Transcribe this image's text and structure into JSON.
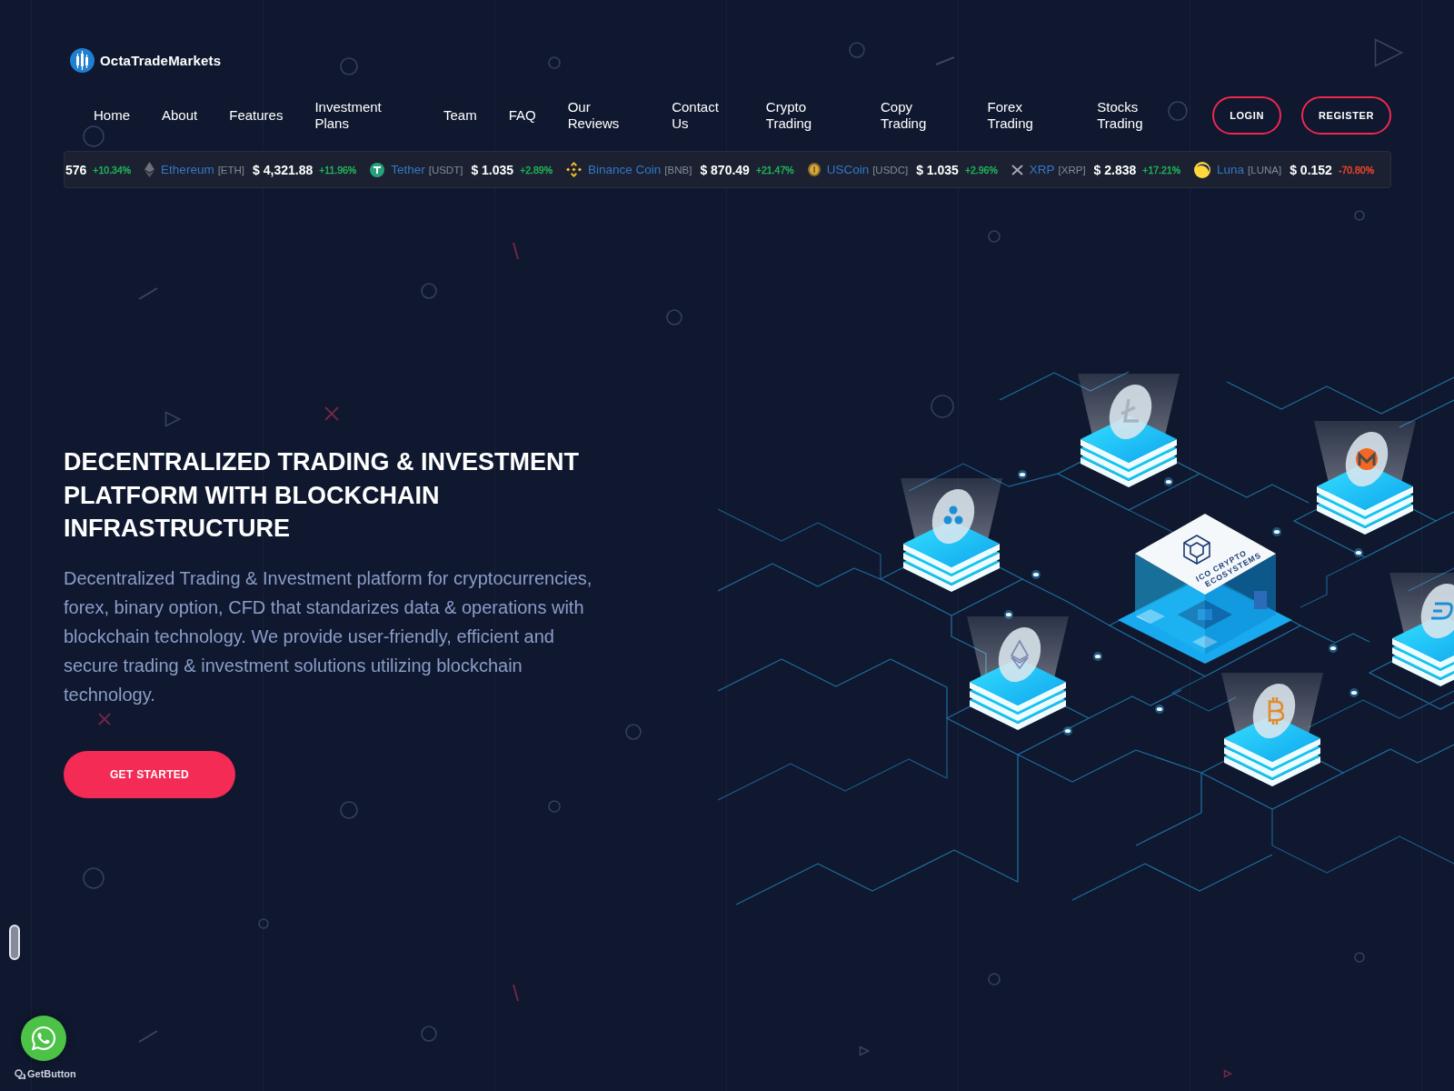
{
  "logo": {
    "name": "OctaTradeMarkets"
  },
  "nav": {
    "items": [
      "Home",
      "About",
      "Features",
      "Investment Plans",
      "Team",
      "FAQ",
      "Our Reviews",
      "Contact Us",
      "Crypto Trading",
      "Copy Trading",
      "Forex Trading",
      "Stocks Trading"
    ]
  },
  "auth_buttons": [
    "LOGIN",
    "REGISTER"
  ],
  "ticker": {
    "items": [
      {
        "price": "576",
        "change": "+10.34%",
        "color": "#21b35b"
      },
      {
        "name": "Ethereum",
        "symbol": "[ETH]",
        "price": "$ 4,321.88",
        "change": "+11.96%",
        "color": "#21b35b"
      },
      {
        "name": "Tether",
        "symbol": "[USDT]",
        "price": "$ 1.035",
        "change": "+2.89%",
        "color": "#21b35b"
      },
      {
        "name": "Binance Coin",
        "symbol": "[BNB]",
        "price": "$ 870.49",
        "change": "+21.47%",
        "color": "#21b35b"
      },
      {
        "name": "USCoin",
        "symbol": "[USDC]",
        "price": "$ 1.035",
        "change": "+2.96%",
        "color": "#21b35b"
      },
      {
        "name": "XRP",
        "symbol": "[XRP]",
        "price": "$ 2.838",
        "change": "+17.21%",
        "color": "#21b35b"
      },
      {
        "name": "Luna",
        "symbol": "[LUNA]",
        "price": "$ 0.152",
        "change": "-70.80%",
        "color": "#f0442c"
      }
    ]
  },
  "hero": {
    "title": "DECENTRALIZED TRADING & INVESTMENT PLATFORM WITH BLOCKCHAIN INFRASTRUCTURE",
    "description": "Decentralized Trading & Investment platform for cryptocurrencies, forex, binary option, CFD that standarizes data & operations with blockchain technology. We provide user-friendly, efficient and secure trading & investment solutions utilizing blockchain technology.",
    "cta": "GET STARTED",
    "illustration": {
      "box_label": [
        "ICO CRYPTO",
        "ECOSYSTEMS"
      ]
    }
  },
  "chat_widget": {
    "label": "GetButton"
  }
}
